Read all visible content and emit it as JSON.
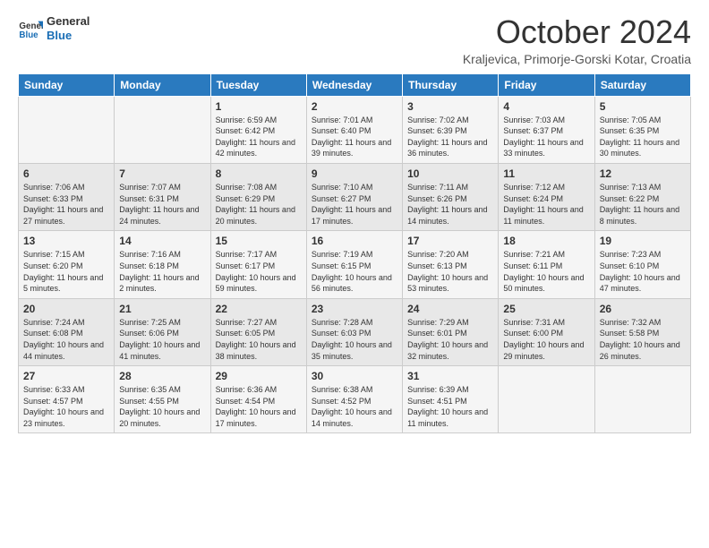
{
  "logo": {
    "text_general": "General",
    "text_blue": "Blue"
  },
  "header": {
    "title": "October 2024",
    "subtitle": "Kraljevica, Primorje-Gorski Kotar, Croatia"
  },
  "weekdays": [
    "Sunday",
    "Monday",
    "Tuesday",
    "Wednesday",
    "Thursday",
    "Friday",
    "Saturday"
  ],
  "weeks": [
    [
      {
        "day": "",
        "sunrise": "",
        "sunset": "",
        "daylight": ""
      },
      {
        "day": "",
        "sunrise": "",
        "sunset": "",
        "daylight": ""
      },
      {
        "day": "1",
        "sunrise": "Sunrise: 6:59 AM",
        "sunset": "Sunset: 6:42 PM",
        "daylight": "Daylight: 11 hours and 42 minutes."
      },
      {
        "day": "2",
        "sunrise": "Sunrise: 7:01 AM",
        "sunset": "Sunset: 6:40 PM",
        "daylight": "Daylight: 11 hours and 39 minutes."
      },
      {
        "day": "3",
        "sunrise": "Sunrise: 7:02 AM",
        "sunset": "Sunset: 6:39 PM",
        "daylight": "Daylight: 11 hours and 36 minutes."
      },
      {
        "day": "4",
        "sunrise": "Sunrise: 7:03 AM",
        "sunset": "Sunset: 6:37 PM",
        "daylight": "Daylight: 11 hours and 33 minutes."
      },
      {
        "day": "5",
        "sunrise": "Sunrise: 7:05 AM",
        "sunset": "Sunset: 6:35 PM",
        "daylight": "Daylight: 11 hours and 30 minutes."
      }
    ],
    [
      {
        "day": "6",
        "sunrise": "Sunrise: 7:06 AM",
        "sunset": "Sunset: 6:33 PM",
        "daylight": "Daylight: 11 hours and 27 minutes."
      },
      {
        "day": "7",
        "sunrise": "Sunrise: 7:07 AM",
        "sunset": "Sunset: 6:31 PM",
        "daylight": "Daylight: 11 hours and 24 minutes."
      },
      {
        "day": "8",
        "sunrise": "Sunrise: 7:08 AM",
        "sunset": "Sunset: 6:29 PM",
        "daylight": "Daylight: 11 hours and 20 minutes."
      },
      {
        "day": "9",
        "sunrise": "Sunrise: 7:10 AM",
        "sunset": "Sunset: 6:27 PM",
        "daylight": "Daylight: 11 hours and 17 minutes."
      },
      {
        "day": "10",
        "sunrise": "Sunrise: 7:11 AM",
        "sunset": "Sunset: 6:26 PM",
        "daylight": "Daylight: 11 hours and 14 minutes."
      },
      {
        "day": "11",
        "sunrise": "Sunrise: 7:12 AM",
        "sunset": "Sunset: 6:24 PM",
        "daylight": "Daylight: 11 hours and 11 minutes."
      },
      {
        "day": "12",
        "sunrise": "Sunrise: 7:13 AM",
        "sunset": "Sunset: 6:22 PM",
        "daylight": "Daylight: 11 hours and 8 minutes."
      }
    ],
    [
      {
        "day": "13",
        "sunrise": "Sunrise: 7:15 AM",
        "sunset": "Sunset: 6:20 PM",
        "daylight": "Daylight: 11 hours and 5 minutes."
      },
      {
        "day": "14",
        "sunrise": "Sunrise: 7:16 AM",
        "sunset": "Sunset: 6:18 PM",
        "daylight": "Daylight: 11 hours and 2 minutes."
      },
      {
        "day": "15",
        "sunrise": "Sunrise: 7:17 AM",
        "sunset": "Sunset: 6:17 PM",
        "daylight": "Daylight: 10 hours and 59 minutes."
      },
      {
        "day": "16",
        "sunrise": "Sunrise: 7:19 AM",
        "sunset": "Sunset: 6:15 PM",
        "daylight": "Daylight: 10 hours and 56 minutes."
      },
      {
        "day": "17",
        "sunrise": "Sunrise: 7:20 AM",
        "sunset": "Sunset: 6:13 PM",
        "daylight": "Daylight: 10 hours and 53 minutes."
      },
      {
        "day": "18",
        "sunrise": "Sunrise: 7:21 AM",
        "sunset": "Sunset: 6:11 PM",
        "daylight": "Daylight: 10 hours and 50 minutes."
      },
      {
        "day": "19",
        "sunrise": "Sunrise: 7:23 AM",
        "sunset": "Sunset: 6:10 PM",
        "daylight": "Daylight: 10 hours and 47 minutes."
      }
    ],
    [
      {
        "day": "20",
        "sunrise": "Sunrise: 7:24 AM",
        "sunset": "Sunset: 6:08 PM",
        "daylight": "Daylight: 10 hours and 44 minutes."
      },
      {
        "day": "21",
        "sunrise": "Sunrise: 7:25 AM",
        "sunset": "Sunset: 6:06 PM",
        "daylight": "Daylight: 10 hours and 41 minutes."
      },
      {
        "day": "22",
        "sunrise": "Sunrise: 7:27 AM",
        "sunset": "Sunset: 6:05 PM",
        "daylight": "Daylight: 10 hours and 38 minutes."
      },
      {
        "day": "23",
        "sunrise": "Sunrise: 7:28 AM",
        "sunset": "Sunset: 6:03 PM",
        "daylight": "Daylight: 10 hours and 35 minutes."
      },
      {
        "day": "24",
        "sunrise": "Sunrise: 7:29 AM",
        "sunset": "Sunset: 6:01 PM",
        "daylight": "Daylight: 10 hours and 32 minutes."
      },
      {
        "day": "25",
        "sunrise": "Sunrise: 7:31 AM",
        "sunset": "Sunset: 6:00 PM",
        "daylight": "Daylight: 10 hours and 29 minutes."
      },
      {
        "day": "26",
        "sunrise": "Sunrise: 7:32 AM",
        "sunset": "Sunset: 5:58 PM",
        "daylight": "Daylight: 10 hours and 26 minutes."
      }
    ],
    [
      {
        "day": "27",
        "sunrise": "Sunrise: 6:33 AM",
        "sunset": "Sunset: 4:57 PM",
        "daylight": "Daylight: 10 hours and 23 minutes."
      },
      {
        "day": "28",
        "sunrise": "Sunrise: 6:35 AM",
        "sunset": "Sunset: 4:55 PM",
        "daylight": "Daylight: 10 hours and 20 minutes."
      },
      {
        "day": "29",
        "sunrise": "Sunrise: 6:36 AM",
        "sunset": "Sunset: 4:54 PM",
        "daylight": "Daylight: 10 hours and 17 minutes."
      },
      {
        "day": "30",
        "sunrise": "Sunrise: 6:38 AM",
        "sunset": "Sunset: 4:52 PM",
        "daylight": "Daylight: 10 hours and 14 minutes."
      },
      {
        "day": "31",
        "sunrise": "Sunrise: 6:39 AM",
        "sunset": "Sunset: 4:51 PM",
        "daylight": "Daylight: 10 hours and 11 minutes."
      },
      {
        "day": "",
        "sunrise": "",
        "sunset": "",
        "daylight": ""
      },
      {
        "day": "",
        "sunrise": "",
        "sunset": "",
        "daylight": ""
      }
    ]
  ]
}
